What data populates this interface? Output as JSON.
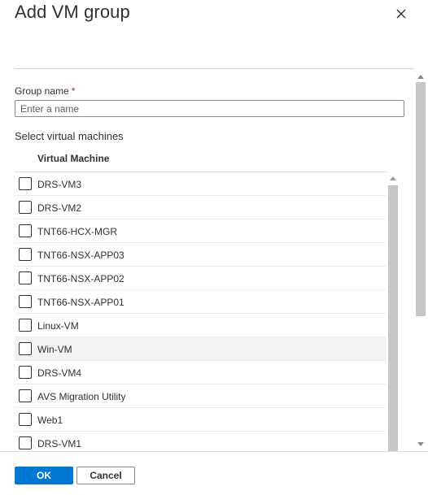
{
  "panel": {
    "title": "Add VM group",
    "close_icon": "close-icon"
  },
  "form": {
    "group_name_label": "Group name",
    "required_marker": "*",
    "group_name_value": "",
    "group_name_placeholder": "Enter a name",
    "select_label": "Select virtual machines"
  },
  "table": {
    "column_header": "Virtual Machine",
    "rows": [
      {
        "label": "DRS-VM3",
        "checked": false
      },
      {
        "label": "DRS-VM2",
        "checked": false
      },
      {
        "label": "TNT66-HCX-MGR",
        "checked": false
      },
      {
        "label": "TNT66-NSX-APP03",
        "checked": false
      },
      {
        "label": "TNT66-NSX-APP02",
        "checked": false
      },
      {
        "label": "TNT66-NSX-APP01",
        "checked": false
      },
      {
        "label": "Linux-VM",
        "checked": false
      },
      {
        "label": "Win-VM",
        "checked": false,
        "hovered": true
      },
      {
        "label": "DRS-VM4",
        "checked": false
      },
      {
        "label": "AVS Migration Utility",
        "checked": false
      },
      {
        "label": "Web1",
        "checked": false
      },
      {
        "label": "DRS-VM1",
        "checked": false
      }
    ]
  },
  "footer": {
    "ok_label": "OK",
    "cancel_label": "Cancel"
  },
  "colors": {
    "primary": "#0078d4",
    "hover_row": "#f3f2f1",
    "required": "#a4262c"
  }
}
